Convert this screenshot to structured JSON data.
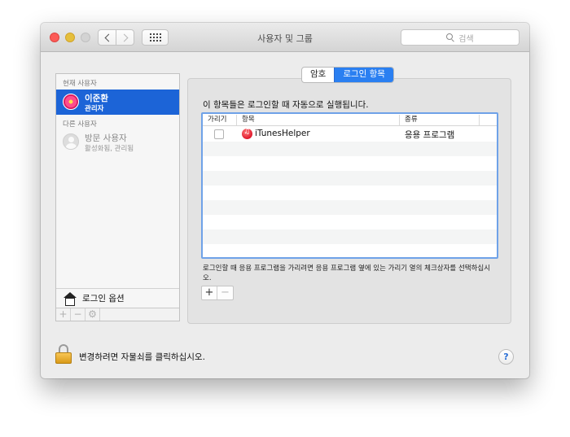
{
  "window": {
    "title": "사용자 및 그룹",
    "search_placeholder": "검색"
  },
  "sidebar": {
    "current_users_header": "현재 사용자",
    "current_user": {
      "name": "이준환",
      "role": "관리자"
    },
    "other_users_header": "다른 사용자",
    "guest_user": {
      "name": "방문 사용자",
      "status": "활성화됨, 관리됨"
    },
    "login_options_label": "로그인 옵션",
    "tools": [
      "+",
      "−",
      "⚙"
    ]
  },
  "tabs": [
    {
      "label": "암호",
      "active": false
    },
    {
      "label": "로그인 항목",
      "active": true
    }
  ],
  "main": {
    "intro": "이 항목들은 로그인할 때 자동으로 실행됩니다.",
    "table": {
      "columns": [
        "가리기",
        "항목",
        "종류"
      ],
      "rows": [
        {
          "hide": false,
          "item": "iTunesHelper",
          "kind": "응용 프로그램"
        }
      ]
    },
    "hint": "로그인할 때 응용 프로그램을 가리려면 응용 프로그램 옆에 있는 가리기 열의 체크상자를 선택하십시오.",
    "add_label": "+",
    "remove_label": "−"
  },
  "footer": {
    "lock_text": "변경하려면 자물쇠를 클릭하십시오.",
    "help_label": "?"
  },
  "colors": {
    "selection": "#1c64d7",
    "tab_active": "#2a7ff1",
    "close": "#fc5b57",
    "minimize": "#e5bf3c"
  }
}
